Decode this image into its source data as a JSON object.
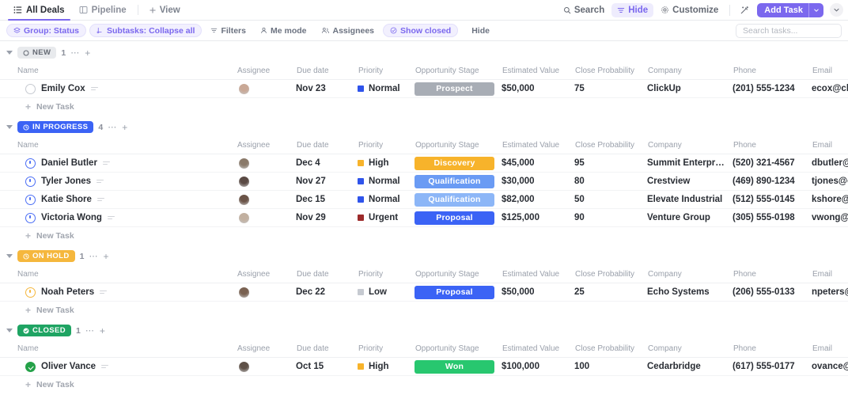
{
  "topbar": {
    "tabs": [
      {
        "label": "All Deals",
        "icon": "list-icon",
        "active": true
      },
      {
        "label": "Pipeline",
        "icon": "board-icon",
        "active": false
      }
    ],
    "add_view_label": "View",
    "right_items": [
      {
        "label": "Search",
        "icon": "search-icon",
        "highlight": false
      },
      {
        "label": "Hide",
        "icon": "hide-icon",
        "highlight": true
      },
      {
        "label": "Customize",
        "icon": "gear-icon",
        "highlight": false
      }
    ],
    "magic_icon": "magic-wand-icon",
    "add_task_label": "Add Task",
    "add_task_caret": "chevron-down-icon",
    "overflow_caret": "chevron-down-icon"
  },
  "filterbar": {
    "pills": [
      {
        "label": "Group: Status",
        "icon": "layers-icon"
      },
      {
        "label": "Subtasks: Collapse all",
        "icon": "subtask-icon"
      },
      {
        "label": "Show closed",
        "icon": "check-circle-icon"
      }
    ],
    "items": [
      {
        "label": "Filters",
        "icon": "filter-icon"
      },
      {
        "label": "Me mode",
        "icon": "person-icon"
      },
      {
        "label": "Assignees",
        "icon": "people-icon"
      },
      {
        "label": "Hide",
        "icon": "none"
      }
    ],
    "search_placeholder": "Search tasks..."
  },
  "columns": [
    "Name",
    "Assignee",
    "Due date",
    "Priority",
    "Opportunity Stage",
    "Estimated Value",
    "Close Probability",
    "Company",
    "Phone",
    "Email"
  ],
  "new_task_label": "New Task",
  "colors": {
    "accent": "#7b68ee",
    "new": "#e8eaed",
    "in_progress": "#3b63f5",
    "on_hold": "#f5b73d",
    "closed": "#1fa463",
    "prospect": "#a8adb5",
    "discovery": "#f7b32b",
    "qualification_1": "#6a9bf4",
    "qualification_2": "#8cb6f7",
    "proposal": "#3b63f5",
    "won": "#28c76f",
    "flag_high": "#f7b32b",
    "flag_normal": "#2f54eb",
    "flag_urgent": "#9c2a2a",
    "flag_low": "#c6cad1"
  },
  "groups": [
    {
      "name": "NEW",
      "status_icon": "circle-open-icon",
      "chip_bg": "#e8eaed",
      "chip_fg": "#656a74",
      "count": "1",
      "row_status": "st-open",
      "tasks": [
        {
          "name": "Emily Cox",
          "avatar": "#c9a896",
          "due": "Nov 23",
          "priority": "Normal",
          "priority_color": "#2f54eb",
          "stage": "Prospect",
          "stage_color": "#a8adb5",
          "value": "$50,000",
          "probability": "75",
          "company": "ClickUp",
          "phone": "(201) 555-1234",
          "email": "ecox@cli"
        }
      ]
    },
    {
      "name": "IN PROGRESS",
      "status_icon": "clock-icon",
      "chip_bg": "#3b63f5",
      "chip_fg": "#ffffff",
      "count": "4",
      "row_status": "st-prog",
      "tasks": [
        {
          "name": "Daniel Butler",
          "avatar": "#8a7a6a",
          "due": "Dec 4",
          "priority": "High",
          "priority_color": "#f7b32b",
          "stage": "Discovery",
          "stage_color": "#f7b32b",
          "value": "$45,000",
          "probability": "95",
          "company": "Summit Enterpris...",
          "phone": "(520) 321-4567",
          "email": "dbutler@"
        },
        {
          "name": "Tyler Jones",
          "avatar": "#5a4a44",
          "due": "Nov 27",
          "priority": "Normal",
          "priority_color": "#2f54eb",
          "stage": "Qualification",
          "stage_color": "#6a9bf4",
          "value": "$30,000",
          "probability": "80",
          "company": "Crestview",
          "phone": "(469) 890-1234",
          "email": "tjones@c"
        },
        {
          "name": "Katie Shore",
          "avatar": "#6b5448",
          "due": "Dec 15",
          "priority": "Normal",
          "priority_color": "#2f54eb",
          "stage": "Qualification",
          "stage_color": "#8cb6f7",
          "value": "$82,000",
          "probability": "50",
          "company": "Elevate Industrial",
          "phone": "(512) 555-0145",
          "email": "kshore@"
        },
        {
          "name": "Victoria Wong",
          "avatar": "#c2b0a0",
          "due": "Nov 29",
          "priority": "Urgent",
          "priority_color": "#9c2a2a",
          "stage": "Proposal",
          "stage_color": "#3b63f5",
          "value": "$125,000",
          "probability": "90",
          "company": "Venture Group",
          "phone": "(305) 555-0198",
          "email": "vwong@"
        }
      ]
    },
    {
      "name": "ON HOLD",
      "status_icon": "pause-circle-icon",
      "chip_bg": "#f5b73d",
      "chip_fg": "#ffffff",
      "count": "1",
      "row_status": "st-hold",
      "tasks": [
        {
          "name": "Noah Peters",
          "avatar": "#7a6252",
          "due": "Dec 22",
          "priority": "Low",
          "priority_color": "#c6cad1",
          "stage": "Proposal",
          "stage_color": "#3b63f5",
          "value": "$50,000",
          "probability": "25",
          "company": "Echo Systems",
          "phone": "(206) 555-0133",
          "email": "npeters@"
        }
      ]
    },
    {
      "name": "CLOSED",
      "status_icon": "check-circle-icon",
      "chip_bg": "#1fa463",
      "chip_fg": "#ffffff",
      "count": "1",
      "row_status": "st-closed",
      "tasks": [
        {
          "name": "Oliver Vance",
          "avatar": "#5f5148",
          "due": "Oct 15",
          "priority": "High",
          "priority_color": "#f7b32b",
          "stage": "Won",
          "stage_color": "#28c76f",
          "value": "$100,000",
          "probability": "100",
          "company": "Cedarbridge",
          "phone": "(617) 555-0177",
          "email": "ovance@"
        }
      ]
    }
  ]
}
